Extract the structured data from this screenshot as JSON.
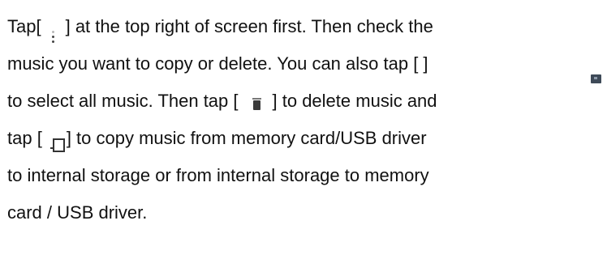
{
  "instructions": {
    "line1_before": "Tap[",
    "line1_after": "] at the top right of screen first. Then check the",
    "line2": "music you want to copy or delete. You can also tap [ ]",
    "line3_before": "to select all music. Then tap [",
    "line3_after": "] to delete music and",
    "line4_before": "tap [",
    "line4_after": "] to copy music from memory card/USB driver",
    "line5": "to internal storage or from internal storage to memory",
    "line6": "card / USB driver."
  },
  "icons": {
    "menu": "vertical-dots-icon",
    "select_all": "select-all-icon",
    "delete": "trash-icon",
    "copy": "copy-icon"
  }
}
